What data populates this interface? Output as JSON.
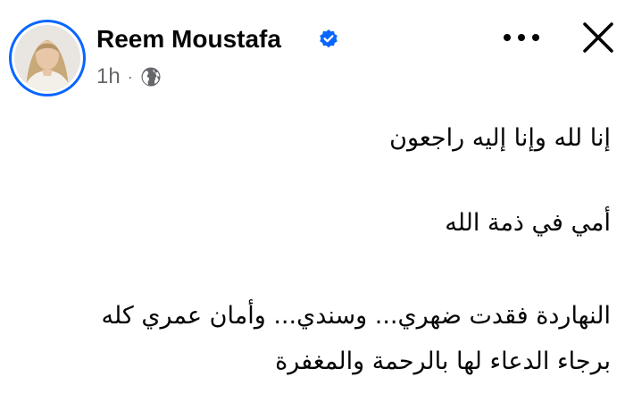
{
  "post": {
    "author": {
      "name": "Reem Moustafa",
      "verified": true,
      "avatar": "profile-photo"
    },
    "meta": {
      "time": "1h",
      "separator": "·",
      "audience_icon": "globe-icon"
    },
    "actions": {
      "more_icon": "more-dots-icon",
      "close_icon": "close-icon"
    },
    "body": {
      "lines": [
        "إنا لله وإنا إليه راجعون",
        "أمي في ذمة الله",
        "النهاردة فقدت ضهري... وسندي... وأمان عمري كله",
        "برجاء الدعاء لها بالرحمة والمغفرة"
      ]
    }
  },
  "colors": {
    "accent": "#0866ff",
    "text": "#050505",
    "secondary": "#65676b",
    "background": "#ffffff"
  }
}
